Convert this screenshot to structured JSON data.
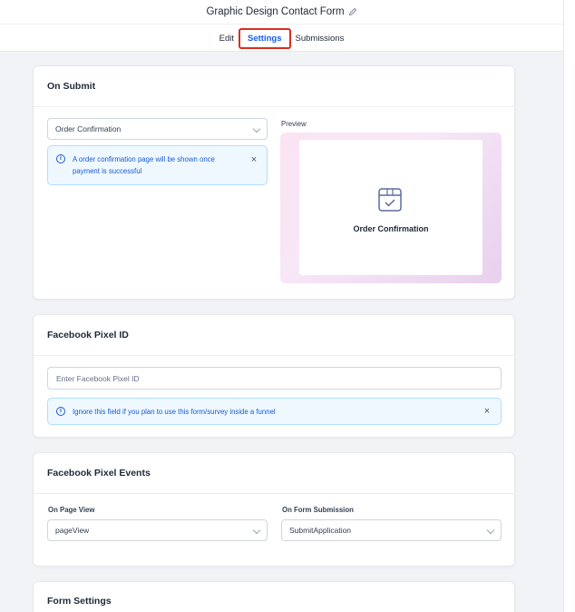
{
  "header": {
    "title": "Graphic Design Contact Form"
  },
  "tabs": [
    {
      "label": "Edit"
    },
    {
      "label": "Settings"
    },
    {
      "label": "Submissions"
    }
  ],
  "on_submit": {
    "heading": "On Submit",
    "select_value": "Order Confirmation",
    "info_text_line1": "A order confirmation page will be shown once",
    "info_text_line2": "payment is successful",
    "preview_label": "Preview",
    "preview_title": "Order Confirmation"
  },
  "pixel_id": {
    "heading": "Facebook Pixel ID",
    "placeholder": "Enter Facebook Pixel ID",
    "info_text": "Ignore this field if you plan to use this form/survey inside a funnel"
  },
  "pixel_events": {
    "heading": "Facebook Pixel Events",
    "page_view_label": "On Page View",
    "page_view_value": "pageView",
    "form_submission_label": "On Form Submission",
    "form_submission_value": "SubmitApplication"
  },
  "form_settings": {
    "heading": "Form Settings"
  },
  "colors": {
    "accent": "#155eef",
    "highlight": "#d92d20",
    "info_bg": "#eff8ff",
    "info_text": "#175cd3"
  },
  "icons": [
    "pencil-icon",
    "info-icon",
    "close-icon",
    "chevron-down-icon",
    "box-check-icon"
  ]
}
